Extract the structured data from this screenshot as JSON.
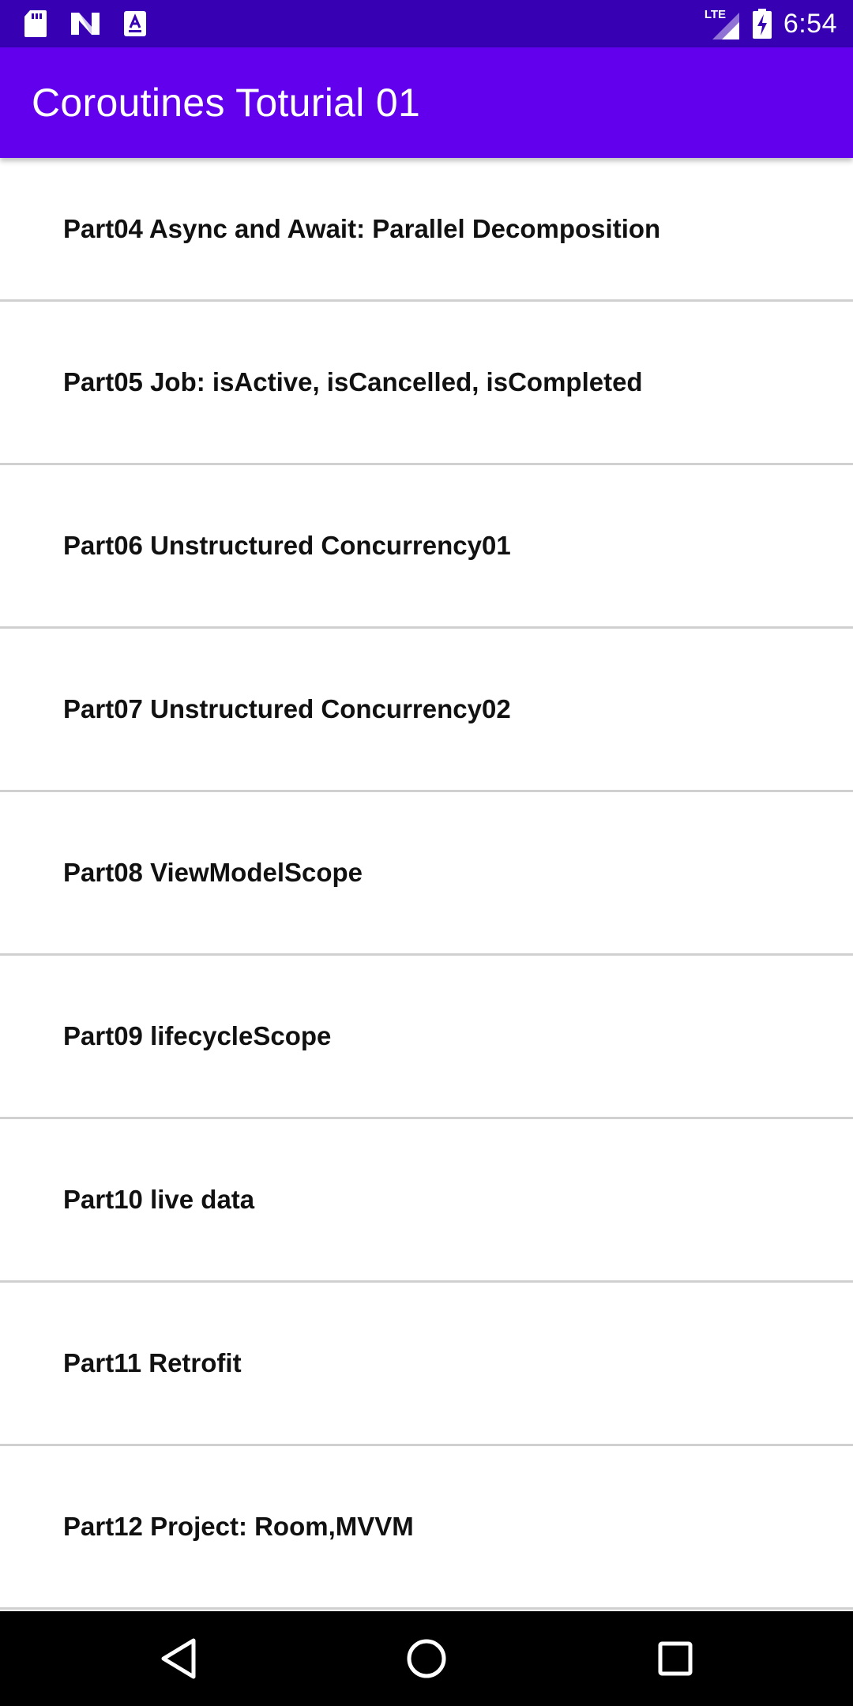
{
  "status_bar": {
    "time": "6:54",
    "network_label": "LTE",
    "icons": [
      "sd-card-icon",
      "n-logo-icon",
      "a-notification-icon",
      "signal-icon",
      "battery-charging-icon"
    ]
  },
  "app_bar": {
    "title": "Coroutines Toturial 01"
  },
  "list": {
    "items": [
      {
        "label": "Part04 Async and Await: Parallel Decomposition"
      },
      {
        "label": "Part05 Job: isActive, isCancelled, isCompleted"
      },
      {
        "label": "Part06 Unstructured Concurrency01"
      },
      {
        "label": "Part07 Unstructured Concurrency02"
      },
      {
        "label": "Part08 ViewModelScope"
      },
      {
        "label": "Part09 lifecycleScope"
      },
      {
        "label": "Part10 live data"
      },
      {
        "label": "Part11 Retrofit"
      },
      {
        "label": "Part12 Project: Room,MVVM"
      }
    ]
  },
  "nav_bar": {
    "buttons": [
      "back-icon",
      "home-icon",
      "recents-icon"
    ]
  },
  "colors": {
    "status_bar": "#3700b3",
    "app_bar": "#6200ee",
    "divider": "#d0d0d0",
    "nav_bar": "#000000"
  }
}
